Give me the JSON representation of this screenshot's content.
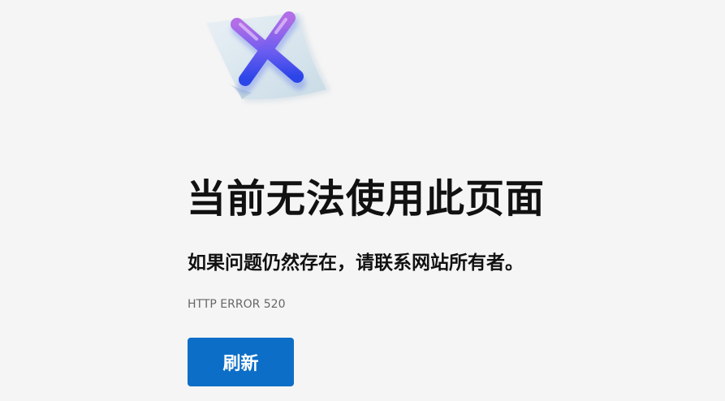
{
  "illustration": {
    "icon": "error-x-icon",
    "paper_color": "#dbe7f0",
    "x_color_top": "#b26ee6",
    "x_color_bottom": "#2c45e8"
  },
  "content": {
    "title": "当前无法使用此页面",
    "subtitle": "如果问题仍然存在，请联系网站所有者。",
    "error_code": "HTTP ERROR 520"
  },
  "actions": {
    "refresh_label": "刷新",
    "refresh_color": "#0c6ec7"
  }
}
